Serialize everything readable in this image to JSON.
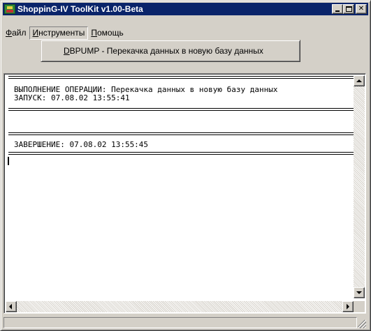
{
  "window": {
    "title": "ShoppinG-IV ToolKit v1.00-Beta",
    "app_icon": "shopping-cart-icon"
  },
  "menubar": {
    "items": [
      {
        "label": "Файл",
        "accel": "Ф",
        "rest": "айл"
      },
      {
        "label": "Инструменты",
        "accel": "И",
        "rest": "нструменты",
        "active": true
      },
      {
        "label": "Помощь",
        "accel": "П",
        "rest": "омощь"
      }
    ]
  },
  "dropdown": {
    "items": [
      {
        "label": "DBPUMP - Перекачка данных в новую базу данных",
        "accel": "D",
        "rest": "BPUMP - Перекачка данных в новую базу данных"
      }
    ]
  },
  "log": {
    "operation_line": "ВЫПОЛНЕНИЕ ОПЕРАЦИИ: Перекачка данных в новую базу данных",
    "start_line": "ЗАПУСК: 07.08.02 13:55:41",
    "end_line": "ЗАВЕРШЕНИЕ: 07.08.02 13:55:45"
  },
  "colors": {
    "titlebar": "#0a246a",
    "face": "#d4d0c8"
  }
}
